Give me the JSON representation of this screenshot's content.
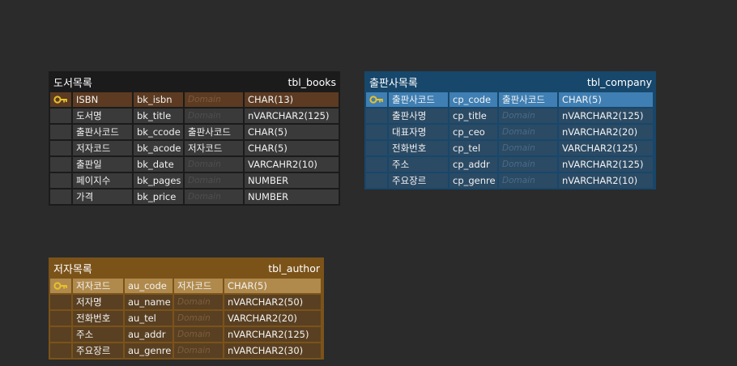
{
  "colors": {
    "background": "#2b2b2b",
    "books_frame": "#1b1b1b",
    "books_pk_row": "#5c3b22",
    "company_frame": "#17476b",
    "company_pk_row": "#3f7fb3",
    "author_frame": "#7b5319",
    "author_pk_row": "#b08a4c",
    "key_icon": "#e8c12a"
  },
  "icons": {
    "primary_key": "key-icon"
  },
  "entities": {
    "books": {
      "logical_name": "도서목록",
      "physical_name": "tbl_books",
      "columns": [
        {
          "logical": "ISBN",
          "physical": "bk_isbn",
          "domain": "Domain",
          "type": "CHAR(13)",
          "pk": true
        },
        {
          "logical": "도서명",
          "physical": "bk_title",
          "domain": "Domain",
          "type": "nVARCHAR2(125)",
          "pk": false
        },
        {
          "logical": "출판사코드",
          "physical": "bk_ccode",
          "domain": "출판사코드",
          "type": "CHAR(5)",
          "pk": false
        },
        {
          "logical": "저자코드",
          "physical": "bk_acode",
          "domain": "저자코드",
          "type": "CHAR(5)",
          "pk": false
        },
        {
          "logical": "출판일",
          "physical": "bk_date",
          "domain": "Domain",
          "type": "VARCAHR2(10)",
          "pk": false
        },
        {
          "logical": "페이지수",
          "physical": "bk_pages",
          "domain": "Domain",
          "type": "NUMBER",
          "pk": false
        },
        {
          "logical": "가격",
          "physical": "bk_price",
          "domain": "Domain",
          "type": "NUMBER",
          "pk": false
        }
      ]
    },
    "company": {
      "logical_name": "출판사목록",
      "physical_name": "tbl_company",
      "columns": [
        {
          "logical": "출판사코드",
          "physical": "cp_code",
          "domain": "출판사코드",
          "type": "CHAR(5)",
          "pk": true
        },
        {
          "logical": "출판사명",
          "physical": "cp_title",
          "domain": "Domain",
          "type": "nVARCHAR2(125)",
          "pk": false
        },
        {
          "logical": "대표자명",
          "physical": "cp_ceo",
          "domain": "Domain",
          "type": "nVARCHAR2(20)",
          "pk": false
        },
        {
          "logical": "전화번호",
          "physical": "cp_tel",
          "domain": "Domain",
          "type": "VARCHAR2(125)",
          "pk": false
        },
        {
          "logical": "주소",
          "physical": "cp_addr",
          "domain": "Domain",
          "type": "nVARCHAR2(125)",
          "pk": false
        },
        {
          "logical": "주요장르",
          "physical": "cp_genre",
          "domain": "Domain",
          "type": "nVARCHAR2(10)",
          "pk": false
        }
      ]
    },
    "author": {
      "logical_name": "저자목록",
      "physical_name": "tbl_author",
      "columns": [
        {
          "logical": "저자코드",
          "physical": "au_code",
          "domain": "저자코드",
          "type": "CHAR(5)",
          "pk": true
        },
        {
          "logical": "저자명",
          "physical": "au_name",
          "domain": "Domain",
          "type": "nVARCHAR2(50)",
          "pk": false
        },
        {
          "logical": "전화번호",
          "physical": "au_tel",
          "domain": "Domain",
          "type": "VARCHAR2(20)",
          "pk": false
        },
        {
          "logical": "주소",
          "physical": "au_addr",
          "domain": "Domain",
          "type": "nVARCHAR2(125)",
          "pk": false
        },
        {
          "logical": "주요장르",
          "physical": "au_genre",
          "domain": "Domain",
          "type": "nVARCHAR2(30)",
          "pk": false
        }
      ]
    }
  }
}
